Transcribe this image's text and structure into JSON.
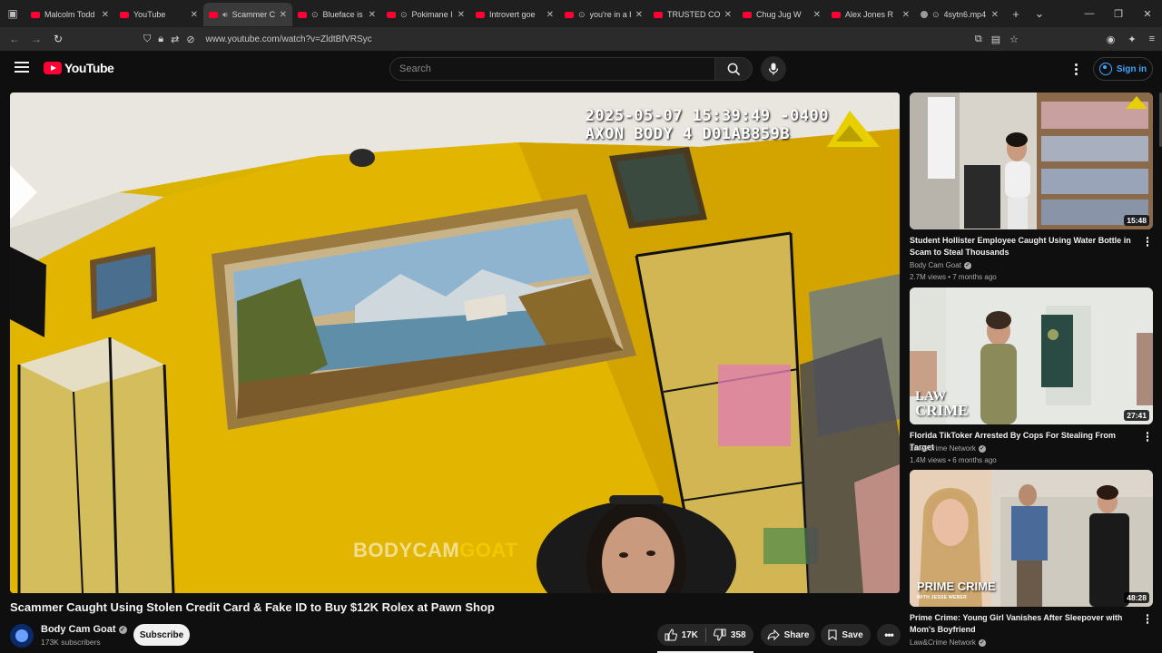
{
  "browser": {
    "tabs": [
      {
        "title": "Malcolm Todd - I",
        "icon": "youtube",
        "active": false
      },
      {
        "title": "YouTube",
        "icon": "youtube",
        "active": false
      },
      {
        "title": "Scammer Ca",
        "icon": "youtube",
        "active": true,
        "audio": true
      },
      {
        "title": "Blueface is d",
        "icon": "youtube",
        "active": false,
        "extra": true
      },
      {
        "title": "Pokimane Is",
        "icon": "youtube",
        "active": false,
        "extra": true
      },
      {
        "title": "Introvert goe",
        "icon": "youtube",
        "active": false
      },
      {
        "title": "you're in a b",
        "icon": "youtube",
        "active": false,
        "extra": true
      },
      {
        "title": "TRUSTED CO",
        "icon": "youtube",
        "active": false
      },
      {
        "title": "Chug Jug W",
        "icon": "youtube",
        "active": false
      },
      {
        "title": "Alex Jones R",
        "icon": "youtube",
        "active": false
      },
      {
        "title": "4sytn6.mp4",
        "icon": "generic",
        "active": false,
        "extra": true
      }
    ],
    "url": "www.youtube.com/watch?v=ZldtBfVRSyc"
  },
  "masthead": {
    "logo_text": "YouTube",
    "search_placeholder": "Search",
    "sign_in": "Sign in"
  },
  "video": {
    "overlay_line1": "2025-05-07 15:39:49 -0400",
    "overlay_line2": "AXON BODY 4 D01AB859B",
    "watermark_a": "BODYCAM",
    "watermark_b": "GOAT",
    "title": "Scammer Caught Using Stolen Credit Card & Fake ID to Buy $12K Rolex at Pawn Shop",
    "channel": "Body Cam Goat",
    "subscribers": "173K subscribers",
    "subscribe": "Subscribe",
    "likes": "17K",
    "dislikes": "358",
    "share": "Share",
    "save": "Save"
  },
  "related": [
    {
      "title": "Student Hollister Employee Caught Using Water Bottle in Scam to Steal Thousands",
      "channel": "Body Cam Goat",
      "verified": true,
      "meta": "2.7M views • 7 months ago",
      "duration": "15:48"
    },
    {
      "title": "Florida TikToker Arrested By Cops For Stealing From Target",
      "channel": "Law&Crime Network",
      "verified": true,
      "meta": "1.4M views • 6 months ago",
      "duration": "27:41",
      "thumb_text_a": "LAW",
      "thumb_text_b": "CRIME"
    },
    {
      "title": "Prime Crime: Young Girl Vanishes After Sleepover with Mom's Boyfriend",
      "channel": "Law&Crime Network",
      "verified": true,
      "meta": "",
      "duration": "48:28",
      "thumb_text_a": "PRIME CRIME",
      "thumb_text_b": "WITH JESSE WEBER"
    }
  ]
}
